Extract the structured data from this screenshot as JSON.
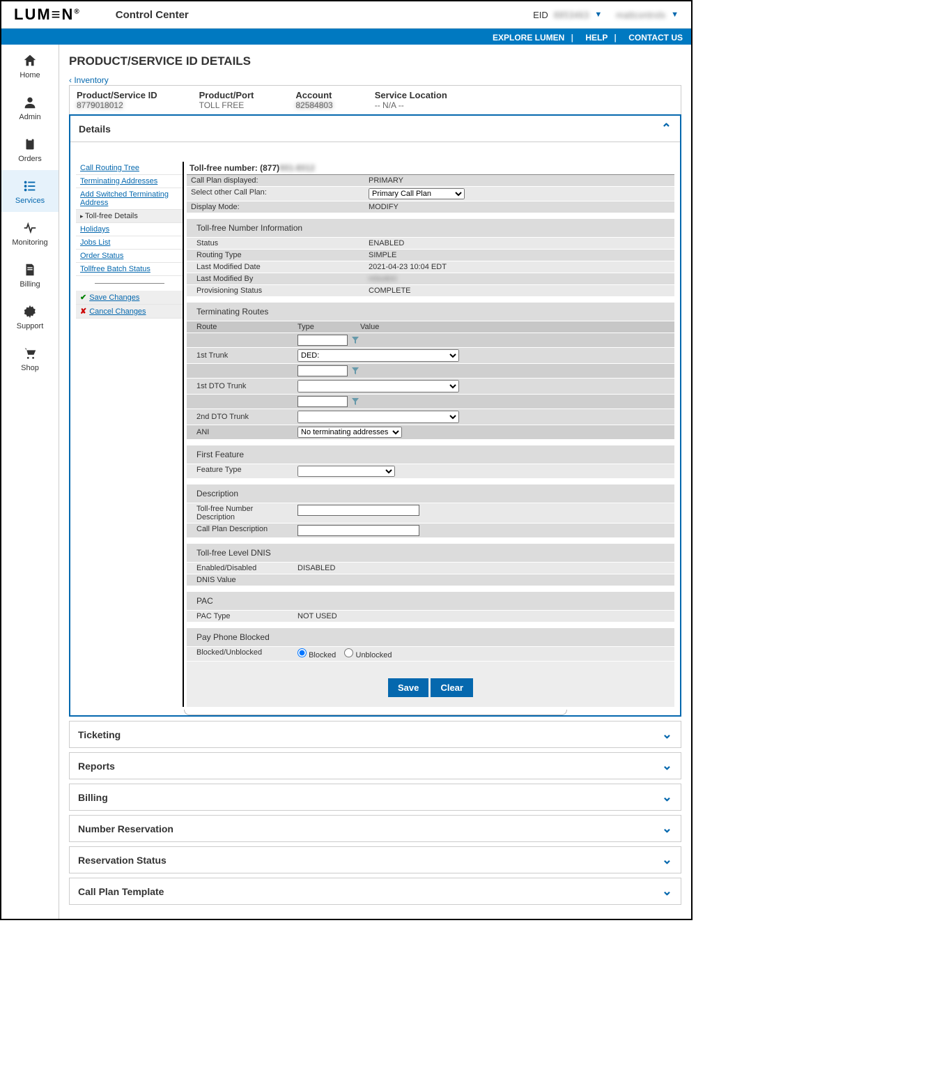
{
  "header": {
    "brand": "LUM≡N",
    "reg": "®",
    "control_center": "Control Center",
    "eid_label": "EID",
    "eid_value": "8853463",
    "user": "mattcontrols"
  },
  "bluebar": {
    "explore": "EXPLORE LUMEN",
    "help": "HELP",
    "contact": "CONTACT US"
  },
  "sidenav": [
    {
      "id": "home",
      "label": "Home"
    },
    {
      "id": "admin",
      "label": "Admin"
    },
    {
      "id": "orders",
      "label": "Orders"
    },
    {
      "id": "services",
      "label": "Services"
    },
    {
      "id": "monitoring",
      "label": "Monitoring"
    },
    {
      "id": "billing",
      "label": "Billing"
    },
    {
      "id": "support",
      "label": "Support"
    },
    {
      "id": "shop",
      "label": "Shop"
    }
  ],
  "page": {
    "title": "PRODUCT/SERVICE ID DETAILS",
    "breadcrumb_back": "Inventory",
    "summary": {
      "psid_label": "Product/Service ID",
      "psid_value": "8779018012",
      "port_label": "Product/Port",
      "port_value": "TOLL FREE",
      "account_label": "Account",
      "account_value": "82584803",
      "loc_label": "Service Location",
      "loc_value": "-- N/A --"
    }
  },
  "tree": {
    "call_routing": "Call Routing Tree",
    "terminating": "Terminating Addresses",
    "add_switched": "Add Switched Terminating Address",
    "tollfree_details": "Toll-free Details",
    "holidays": "Holidays",
    "jobs": "Jobs List",
    "order_status": "Order Status",
    "batch_status": "Tollfree Batch Status",
    "save": "Save Changes",
    "cancel": "Cancel Changes"
  },
  "form": {
    "tf_number_label": "Toll-free number: (877)",
    "tf_number_value": "901-8012",
    "call_plan_displayed_label": "Call Plan displayed:",
    "call_plan_displayed_value": "PRIMARY",
    "select_other_label": "Select other Call Plan:",
    "select_other_value": "Primary Call Plan",
    "display_mode_label": "Display Mode:",
    "display_mode_value": "MODIFY",
    "info_head": "Toll-free Number Information",
    "status_label": "Status",
    "status_value": "ENABLED",
    "routing_label": "Routing Type",
    "routing_value": "SIMPLE",
    "lastmod_label": "Last Modified Date",
    "lastmod_value": "2021-04-23 10:04 EDT",
    "lastmodby_label": "Last Modified By",
    "lastmodby_value": "mtsukini",
    "prov_label": "Provisioning Status",
    "prov_value": "COMPLETE",
    "routes_head": "Terminating Routes",
    "col_route": "Route",
    "col_type": "Type",
    "col_value": "Value",
    "trunk1": "1st Trunk",
    "trunk1_sel": "DED:",
    "dto1": "1st DTO Trunk",
    "dto2": "2nd DTO Trunk",
    "ani": "ANI",
    "ani_sel": "No terminating addresses available.",
    "feature_head": "First Feature",
    "feature_type": "Feature Type",
    "desc_head": "Description",
    "tf_desc": "Toll-free Number Description",
    "cp_desc": "Call Plan Description",
    "dnis_head": "Toll-free Level DNIS",
    "dnis_enabled": "Enabled/Disabled",
    "dnis_enabled_val": "DISABLED",
    "dnis_value": "DNIS Value",
    "pac_head": "PAC",
    "pac_type": "PAC Type",
    "pac_type_val": "NOT USED",
    "pay_head": "Pay Phone Blocked",
    "pay_label": "Blocked/Unblocked",
    "blocked": "Blocked",
    "unblocked": "Unblocked",
    "save_btn": "Save",
    "clear_btn": "Clear"
  },
  "panels": {
    "details": "Details",
    "ticketing": "Ticketing",
    "reports": "Reports",
    "billing": "Billing",
    "number_reservation": "Number Reservation",
    "reservation_status": "Reservation Status",
    "call_plan_template": "Call Plan Template"
  }
}
